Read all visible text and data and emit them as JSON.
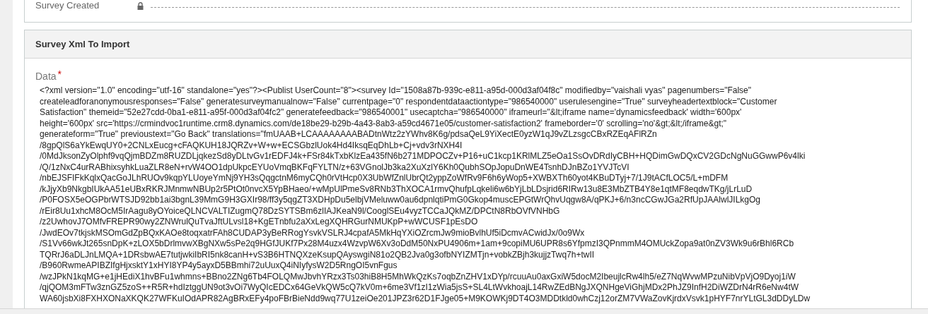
{
  "fields": [
    {
      "label": "Survey Created",
      "locked": true
    }
  ],
  "section": {
    "title": "Survey Xml To Import",
    "field": {
      "label": "Data",
      "required_mark": "*",
      "value_lines": [
        "<?xml version=\"1.0\" encoding=\"utf-16\" standalone=\"yes\"?><Publist UserCount=\"8\"><survey Id=\"1508a87b-939c-e811-a95d-000d3af04f8c\" modifiedby=\"vaishali vyas\" pagenumbers=\"False\"",
        "createleadforanonymousresponses=\"False\" generatesurveymanualnow=\"False\" currentpage=\"0\" respondentdataactiontype=\"986540000\" userulesengine=\"True\" surveyheadertextblock=\"Customer",
        "Satisfaction\" themeid=\"52e27cdd-0ba1-e811-a95f-000d3af04fc2\" generatefeedback=\"986540001\" usecaptcha=\"986540000\" iframeurl=\"&lt;iframe name='dynamicsfeedback' width='600px'",
        "height='600px' src='https://crmindvoc1runtime.crm8.dynamics.com/de18be29-b29b-4a43-8ab3-a59cd4671e05/customer-satisfaction2' frameborder='0' scrolling='no'&gt;&lt;/iframe&gt;\"",
        "generateform=\"True\" previoustext=\"Go Back\" translations=\"fmUAAB+LCAAAAAAAABADtnWtz2zYWhv8K6g/pdsaQeL9YiXectE0yzW1qJ9vZLzsgcCBxRZEqAFlRZn",
        "/8gpQlS6aYkEwqUY0+2CNLxEucg+cFAQKUH18JQRZv+W+w+ECSGbzlUok4Hd4IksqEqDhLb+Cj+vdv3rNXH4I",
        "/0MdJksonZyOlphf9vqQjmBDZm8RUZDLjqkezSd8yDLtvGv1rEDFJ4k+FSr84kTxbKlzEa435fN6b271MDPOCZv+P16+uC1kcp1KRlMLZ5eOa1SsOvDRdIyCBH+HQDimGwDQxCV2GDcNgNuGGwwP6v4lki",
        "/Q/1zNxC4urRABhixsyhkLuaZLR8eN+rvW4OO1dpUkpcEYUoVmqBKFqFYLTN/z+63VGnolJb3ka2XuXzlY6Kh0QubhSOpJopuDnWE4TsnhDJnBZo1YVJTcVI",
        "/nbEJSFIFkKqlxQacGoJLhRUOv9kqpYLUoyeYmNj9YH3sQqgctnM6myCQh0rVtHcp0X3UbWfZnlUbrQt2yppZoWfRv9F6h6yWop5+XWBXTh60yot4KBuDTyj+7/1J9tACfLOC5/L+mDFM",
        "/kJjyXb9NkgbIUkAA51eUBxRKRJMnmwNBUp2r5PtOt0nvcX5YpBHaeo/+wMpUlPmeSv8RNb3ThXOCA1rmvQhufpLqkeli6w6bYjLbLDsjrid6RIRw13u8E3MbZTB4Y8e1qtMF8eqdwTKg/jLrLuD",
        "/P0FOSX5eOGPbrWTSJD92bb1ai3bgnL39MmG9H3GXIr98/ff3y5qgZT3XDHpDu5elbjVMeluww0au6dpnlqtiPmG0Gkop4muscEPGtWrQhvUqgw8A/qPKJ+6/n3ncCGwJGa2RfUpJAAlwlJILkgOg",
        "/rEir8Uu1xhcM8OcM5IrAagu8yOYoiceQLNCVALTIZugmQ78DzSYTSBm6zlIAJKeaN9l/CooglSEu4vyzTCCaJQkMZ/DPCtN8RbOVfVNHbG",
        "/z2UwhovJ7OMfvFREPR90wy2ZNWrulQuTvaJftULvsl18+KgETnbfu2aXxLegXQHRGurNMUKpP+wWCUSF1pEsDO",
        "/JwdEOv7tkjskMSOmGdZpBQxKAOe8toqxatrFAh8CUDAP3yBeRRogYsvkVSLRJ4cpafA5MkHqYXiOZrcmJw9mioBvlhUf5iDcmvACwidJx/0o9Wx",
        "/S1Vv66wkJt265snDpK+zLOX5bDrlmvwXBgNXw5sPe2q9HGfJUKf7Px28M4uzx4WzvpW6Xv3oDdM50NxPU4906m+1am+9copiMU6UPR8s6YfpmzI3QPnmmM4OMUckZopa9at0nZV3Wk9u6rBhl6RCb",
        "TQRrJ6aDLJnLMQA+1DRsbwAE7tutjwkiIbRI5nk8canH+vS3B6HTNQXzeKsupQAyswgiN81o2QB2Jva0g3ofbNYIZMTjn+vobkZBjh3kujjzTwq7h+twII",
        "/B960RwmeAPIBZIfgHjxsktY1xHYI8YP4y5ayxD5BBmhi72uUuxQ4iNIyfysW2D5RngOI5vnFgus",
        "/wzJPkN1kqMG+e1jHEdiX1hvBFu1whmns+BBno2ZNg6Tb4FOLQMwJbvhYRzx3Ts03hiB8H5MhWkQzKs7oqbZnZHV1xDYp/rcuuAu0axGxiW5docM2IbeujlcRw4lh5/eZ7NqWvwMPzuNibVpVjO9Dyoj1iW",
        "/qjQOM3mFTw3znGZ5zoS++R5R+hdIztggUN9ot3vOi7WyQIcEDCx64GeVkQW5cQ7kV0m+6me3Vf1zI1zWia5jsS+SL4LtWvkhoajL14RwZEdBNgJXQNHgeViGhjMDx2PhJZ9InfH2DiWZDrN4rR6eNw4tW",
        "WA60jsbXi8FXHXONaXKQK27WFKuIOdAPR82AgBRxEFy4poFBrBieNdd9wq77U1zeiOe201JPZ3r62D1FJge05+M9KOWKj9DT4O3MDDtkld0whCzj12orZM7VWaZovKjrdxVsvk1pHYF7nrYLtGL3dDDyLDw"
      ]
    }
  }
}
